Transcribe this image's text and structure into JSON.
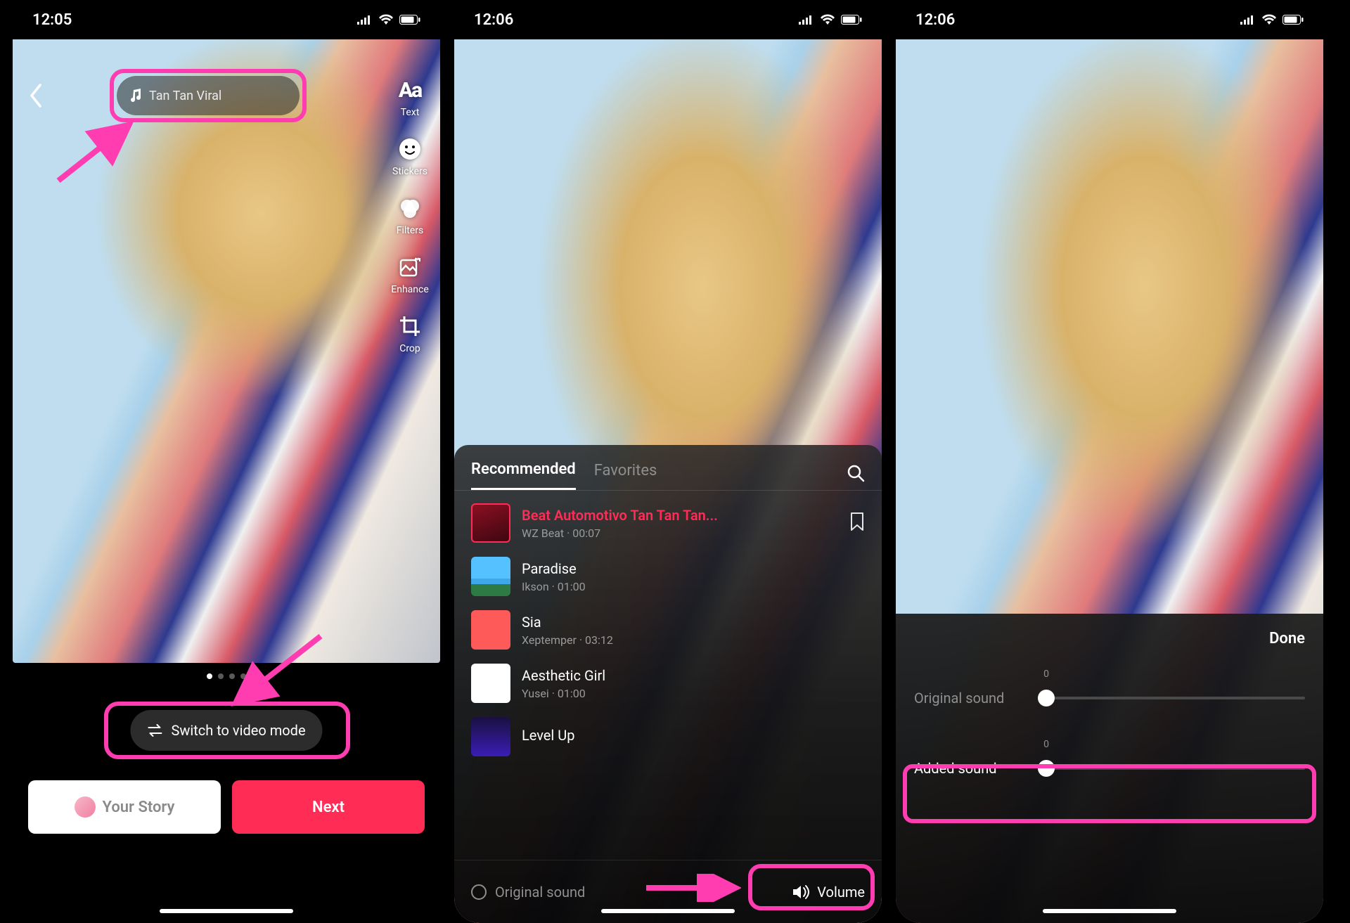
{
  "colors": {
    "accent": "#ff2d55",
    "highlight": "#ff3db0"
  },
  "phone1": {
    "status": {
      "time": "12:05"
    },
    "soundChip": "Tan Tan Viral",
    "tools": {
      "text": "Text",
      "stickers": "Stickers",
      "filters": "Filters",
      "enhance": "Enhance",
      "crop": "Crop"
    },
    "switchMode": "Switch to video mode",
    "your_story": "Your Story",
    "next": "Next"
  },
  "phone2": {
    "status": {
      "time": "12:06"
    },
    "tabs": {
      "recommended": "Recommended",
      "favorites": "Favorites"
    },
    "songs": [
      {
        "title": "Beat Automotivo Tan Tan Tan...",
        "sub": "WZ Beat · 00:07",
        "selected": true
      },
      {
        "title": "Paradise",
        "sub": "Ikson · 01:00"
      },
      {
        "title": "Sia",
        "sub": "Xeptemper · 03:12"
      },
      {
        "title": "Aesthetic Girl",
        "sub": "Yusei · 01:00"
      },
      {
        "title": "Level Up",
        "sub": ""
      }
    ],
    "original_sound": "Original sound",
    "volume": "Volume"
  },
  "phone3": {
    "status": {
      "time": "12:06"
    },
    "done": "Done",
    "original_label": "Original sound",
    "original_value": "0",
    "added_label": "Added sound",
    "added_value": "0"
  }
}
